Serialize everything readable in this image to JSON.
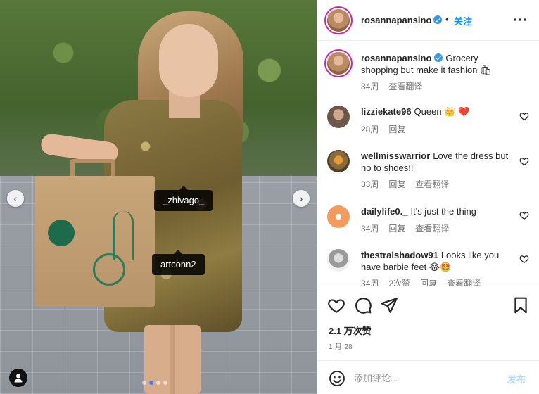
{
  "post": {
    "author": "rosannapansino",
    "follow_label": "关注",
    "separator": "•",
    "caption": {
      "user": "rosannapansino",
      "text": "Grocery shopping but make it fashion 🛍",
      "age": "34周",
      "translate": "查看翻译"
    },
    "photo_tags": [
      "_zhivago_",
      "artconn2"
    ],
    "carousel": {
      "dot_count": 4,
      "active_index": 1
    },
    "likes_label": "2.1 万次赞",
    "date_label": "1 月 28"
  },
  "comments": [
    {
      "user": "lizziekate96",
      "text": "Queen 👑 ❤️",
      "age": "28周",
      "reply": "回复"
    },
    {
      "user": "wellmisswarrior",
      "text": "Love the dress but no to shoes!!",
      "age": "33周",
      "reply": "回复",
      "translate": "查看翻译"
    },
    {
      "user": "dailylife0._",
      "text": "It's just the thing",
      "age": "34周",
      "reply": "回复",
      "translate": "查看翻译"
    },
    {
      "user": "thestralshadow91",
      "text": "Looks like you have barbie feet 😂🤩",
      "age": "34周",
      "likes": "2次赞",
      "reply": "回复",
      "translate": "查看翻译"
    }
  ],
  "composer": {
    "placeholder": "添加评论...",
    "post_label": "发布"
  },
  "icons": {
    "like": "heart-icon",
    "comment": "comment-icon",
    "share": "share-icon",
    "save": "bookmark-icon",
    "more": "more-icon",
    "emoji": "emoji-icon",
    "verified": "verified-badge-icon",
    "prev": "chevron-left-icon",
    "next": "chevron-right-icon",
    "tagged_users": "user-icon"
  },
  "colors": {
    "accent": "#0095f6",
    "verified": "#3897f0",
    "post_button_disabled": "#b3dbff",
    "meta_text": "#737373",
    "carousel_active_dot": "#3b82f6"
  }
}
